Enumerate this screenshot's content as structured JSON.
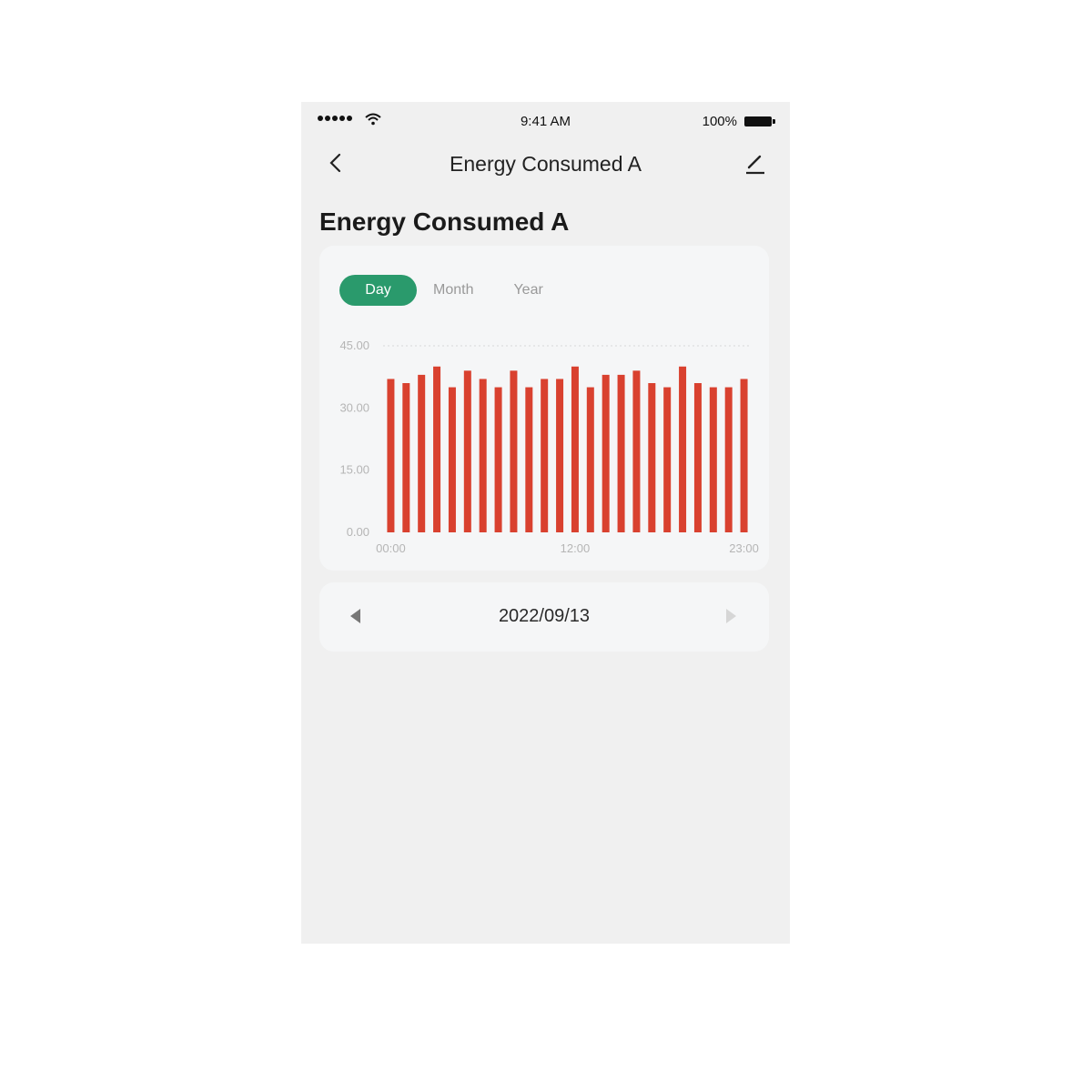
{
  "status_bar": {
    "time": "9:41 AM",
    "battery": "100%"
  },
  "nav": {
    "title": "Energy Consumed A",
    "back_icon": "chevron-left-icon",
    "edit_icon": "pencil-icon"
  },
  "page_title": "Energy Consumed A",
  "tabs": [
    {
      "label": "Day",
      "active": true
    },
    {
      "label": "Month",
      "active": false
    },
    {
      "label": "Year",
      "active": false
    }
  ],
  "date_picker": {
    "date": "2022/09/13",
    "prev_icon": "triangle-left-icon",
    "next_icon": "triangle-right-icon"
  },
  "colors": {
    "accent": "#2a9a6c",
    "bar": "#d9412f"
  },
  "chart_data": {
    "type": "bar",
    "title": "",
    "xlabel": "",
    "ylabel": "",
    "ylim": [
      0,
      45
    ],
    "yticks": [
      "0.00",
      "15.00",
      "30.00",
      "45.00"
    ],
    "ytick_values": [
      0,
      15,
      30,
      45
    ],
    "xtick_labels": [
      {
        "index": 0,
        "label": "00:00"
      },
      {
        "index": 12,
        "label": "12:00"
      },
      {
        "index": 23,
        "label": "23:00"
      }
    ],
    "categories": [
      "00:00",
      "01:00",
      "02:00",
      "03:00",
      "04:00",
      "05:00",
      "06:00",
      "07:00",
      "08:00",
      "09:00",
      "10:00",
      "11:00",
      "12:00",
      "13:00",
      "14:00",
      "15:00",
      "16:00",
      "17:00",
      "18:00",
      "19:00",
      "20:00",
      "21:00",
      "22:00",
      "23:00"
    ],
    "values": [
      37,
      36,
      38,
      40,
      35,
      39,
      37,
      35,
      39,
      35,
      37,
      37,
      40,
      35,
      38,
      38,
      39,
      36,
      35,
      40,
      36,
      35,
      35,
      37
    ],
    "grid": "dotted line at max",
    "legend": "none"
  }
}
